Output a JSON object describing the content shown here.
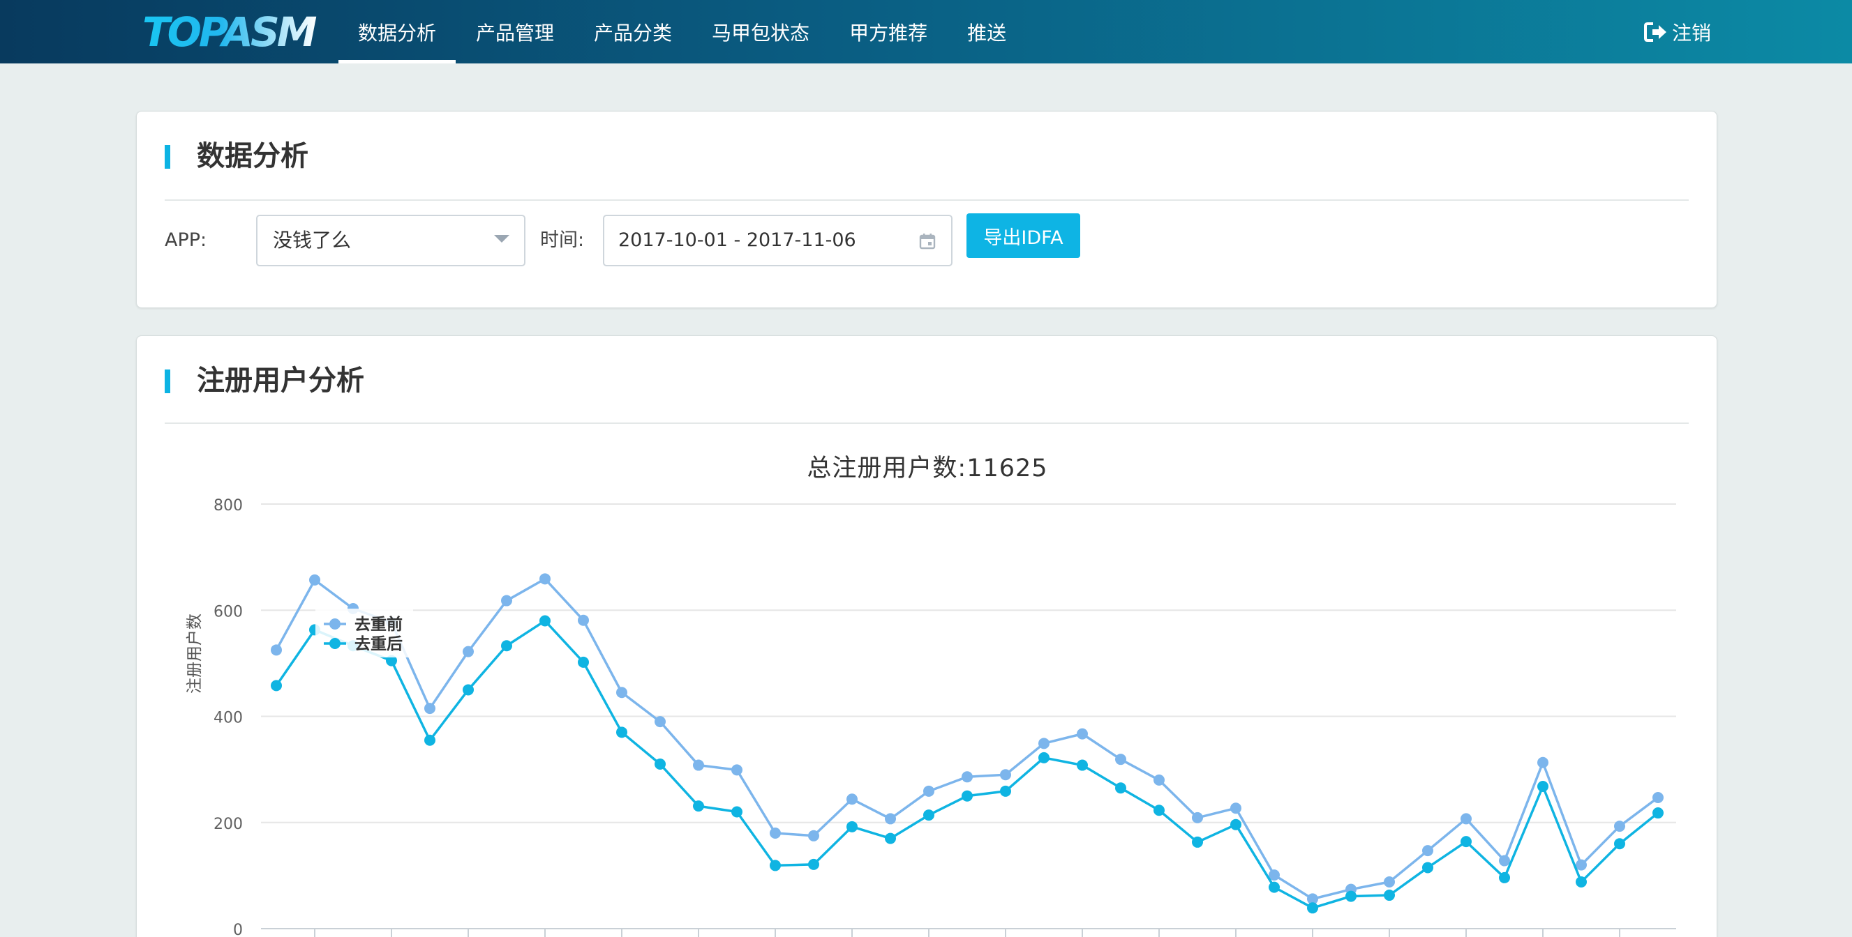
{
  "brand": {
    "logo_text": "TOPASM",
    "nav_bg_start": "#083a5e",
    "nav_bg_end": "#0c8aa5",
    "accent": "#0eb4e4"
  },
  "nav": {
    "items": [
      "数据分析",
      "产品管理",
      "产品分类",
      "马甲包状态",
      "甲方推荐",
      "推送"
    ],
    "active_index": 0,
    "logout_label": "注销"
  },
  "filter_card": {
    "title": "数据分析",
    "app_label": "APP:",
    "app_value": "没钱了么",
    "time_label": "时间:",
    "date_range": "2017-10-01 - 2017-11-06",
    "export_button": "导出IDFA"
  },
  "chart_card": {
    "title": "注册用户分析"
  },
  "chart_data": {
    "type": "line",
    "title": "总注册用户数:11625",
    "ylabel": "注册用户数",
    "xlabel": "",
    "ylim": [
      0,
      800
    ],
    "yticks": [
      0,
      200,
      400,
      600,
      800
    ],
    "grid": true,
    "legend_position": "top-left",
    "series": [
      {
        "name": "去重前",
        "color": "#7cb5ec",
        "values": [
          525,
          657,
          603,
          577,
          415,
          522,
          618,
          659,
          581,
          445,
          390,
          308,
          299,
          180,
          175,
          244,
          207,
          259,
          286,
          290,
          349,
          367,
          319,
          280,
          209,
          227,
          101,
          56,
          74,
          88,
          147,
          207,
          128,
          313,
          120,
          193,
          247
        ]
      },
      {
        "name": "去重后",
        "color": "#0fb4e2",
        "values": [
          458,
          563,
          533,
          505,
          355,
          450,
          533,
          580,
          502,
          370,
          310,
          231,
          220,
          119,
          121,
          192,
          170,
          214,
          250,
          259,
          322,
          308,
          265,
          223,
          163,
          196,
          78,
          39,
          61,
          63,
          115,
          164,
          96,
          268,
          88,
          160,
          218
        ]
      }
    ]
  }
}
